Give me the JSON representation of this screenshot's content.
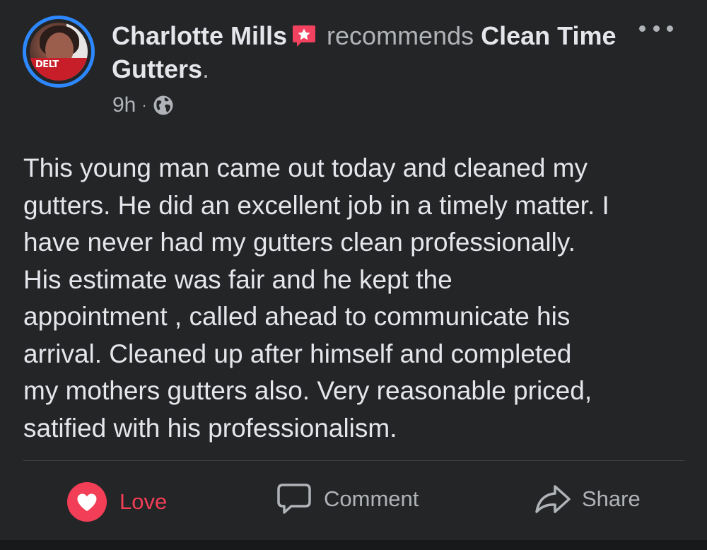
{
  "post": {
    "author": "Charlotte Mills",
    "verb": "recommends",
    "page_name": "Clean Time Gutters",
    "period": ".",
    "time": "9h",
    "separator": "·",
    "avatar_badge": "DELT",
    "body": "This young man came out today and cleaned my\ngutters. He did an excellent job in a timely matter. I\nhave never had my gutters clean professionally.\nHis estimate was fair and he kept the\nappointment , called ahead to communicate his\narrival.  Cleaned up after himself and completed\nmy mothers gutters also. Very reasonable priced,\nsatified with his professionalism."
  },
  "actions": {
    "love_label": "Love",
    "comment_label": "Comment",
    "share_label": "Share"
  },
  "icons": {
    "recommend": "recommend-star-icon",
    "privacy": "globe-icon",
    "more": "more-options-icon",
    "love": "heart-icon",
    "comment": "comment-bubble-icon",
    "share": "share-arrow-icon"
  },
  "colors": {
    "background": "#242526",
    "text": "#e4e6eb",
    "secondary": "#b0b3b8",
    "love": "#f33e58",
    "avatar_ring": "#2d88ff",
    "recommend_badge": "#f3425f"
  }
}
